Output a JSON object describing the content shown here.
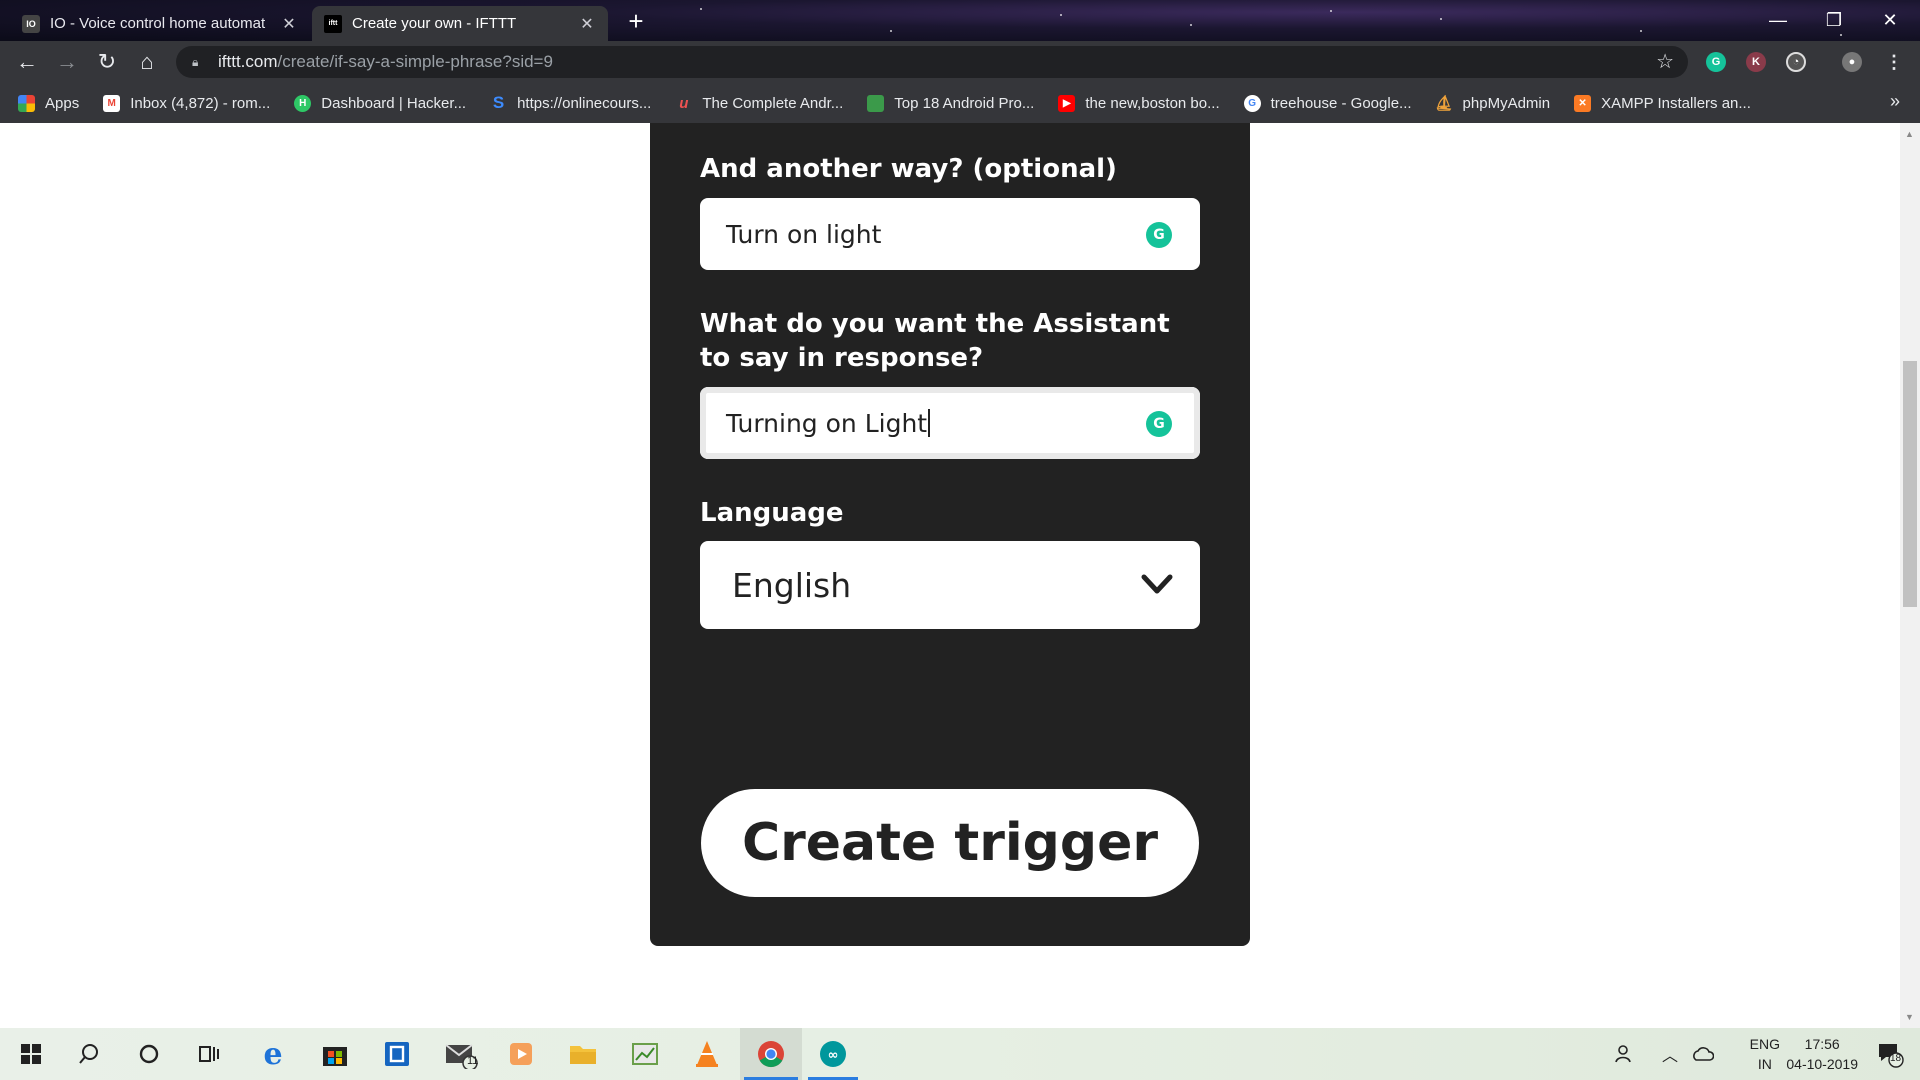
{
  "browser": {
    "tabs": [
      {
        "title": "IO - Voice control home automat",
        "active": false,
        "favicon": "io-icon"
      },
      {
        "title": "Create your own - IFTTT",
        "active": true,
        "favicon": "ifttt-icon"
      }
    ],
    "url_host": "ifttt.com",
    "url_path": "/create/if-say-a-simple-phrase?sid=9",
    "bookmarks": [
      {
        "label": "Apps",
        "icon": "apps-grid-icon",
        "color": "#ffffff"
      },
      {
        "label": "Inbox (4,872) - rom...",
        "icon": "gmail-icon",
        "color": "#ea4335"
      },
      {
        "label": "Dashboard | Hacker...",
        "icon": "hackerrank-icon",
        "color": "#2ec866"
      },
      {
        "label": "https://onlinecours...",
        "icon": "s-icon",
        "color": "#1e6bd6"
      },
      {
        "label": "The Complete Andr...",
        "icon": "udemy-icon",
        "color": "#ec5252"
      },
      {
        "label": "Top 18 Android Pro...",
        "icon": "doc-icon",
        "color": "#3b9a4a"
      },
      {
        "label": "the new,boston bo...",
        "icon": "youtube-icon",
        "color": "#ff0000"
      },
      {
        "label": "treehouse - Google...",
        "icon": "google-icon",
        "color": "#ffffff"
      },
      {
        "label": "phpMyAdmin",
        "icon": "phpmyadmin-icon",
        "color": "#f0a33a"
      },
      {
        "label": "XAMPP Installers an...",
        "icon": "xampp-icon",
        "color": "#fb7a24"
      }
    ]
  },
  "form": {
    "another_way_label": "And another way? (optional)",
    "another_way_value": "Turn on light",
    "response_label": "What do you want the Assistant to say in response?",
    "response_value": "Turning on Light",
    "language_label": "Language",
    "language_value": "English",
    "submit_label": "Create trigger"
  },
  "taskbar": {
    "lang_line1": "ENG",
    "lang_line2": "IN",
    "time": "17:56",
    "date": "04-10-2019",
    "notifications_count": "18",
    "mail_badge": "11"
  },
  "colors": {
    "card_bg": "#222222",
    "grammarly": "#15c39a",
    "taskbar_accent": "#2b7de0"
  }
}
